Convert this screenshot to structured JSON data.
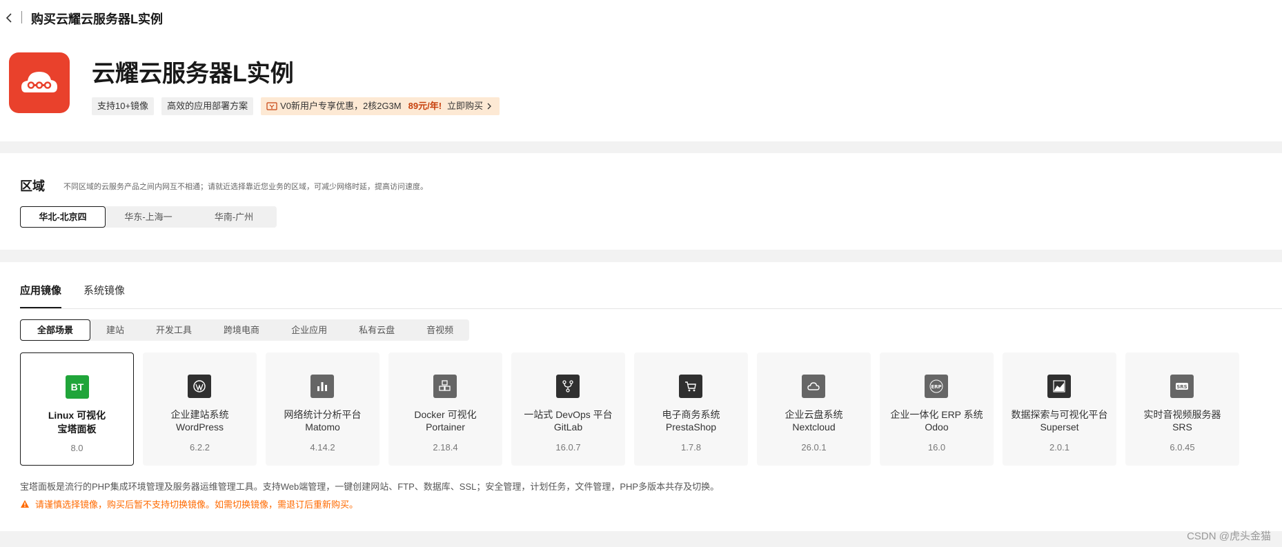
{
  "header": {
    "title": "购买云耀云服务器L实例"
  },
  "hero": {
    "title": "云耀云服务器L实例",
    "tags": [
      "支持10+镜像",
      "高效的应用部署方案"
    ],
    "promo": {
      "text": "V0新用户专享优惠，2核2G3M",
      "price": "89元/年!",
      "link": "立即购买"
    }
  },
  "region": {
    "label": "区域",
    "description": "不同区域的云服务产品之间内网互不相通；请就近选择靠近您业务的区域，可减少网络时延，提高访问速度。",
    "options": [
      "华北-北京四",
      "华东-上海一",
      "华南-广州"
    ],
    "selected": "华北-北京四"
  },
  "images": {
    "tabs": [
      "应用镜像",
      "系统镜像"
    ],
    "active_tab": "应用镜像",
    "categories": [
      "全部场景",
      "建站",
      "开发工具",
      "跨境电商",
      "企业应用",
      "私有云盘",
      "音视频"
    ],
    "active_category": "全部场景",
    "cards": [
      {
        "line1": "Linux 可视化",
        "line2": "宝塔面板",
        "version": "8.0",
        "icon": "bt-icon"
      },
      {
        "line1": "企业建站系统",
        "line2": "WordPress",
        "version": "6.2.2",
        "icon": "wordpress-icon"
      },
      {
        "line1": "网络统计分析平台",
        "line2": "Matomo",
        "version": "4.14.2",
        "icon": "bar-chart-icon"
      },
      {
        "line1": "Docker 可视化",
        "line2": "Portainer",
        "version": "2.18.4",
        "icon": "cubes-icon"
      },
      {
        "line1": "一站式 DevOps 平台",
        "line2": "GitLab",
        "version": "16.0.7",
        "icon": "branch-icon"
      },
      {
        "line1": "电子商务系统",
        "line2": "PrestaShop",
        "version": "1.7.8",
        "icon": "cart-icon"
      },
      {
        "line1": "企业云盘系统",
        "line2": "Nextcloud",
        "version": "26.0.1",
        "icon": "cloud-icon"
      },
      {
        "line1": "企业一体化 ERP 系统",
        "line2": "Odoo",
        "version": "16.0",
        "icon": "erp-icon"
      },
      {
        "line1": "数据探索与可视化平台",
        "line2": "Superset",
        "version": "2.0.1",
        "icon": "area-chart-icon"
      },
      {
        "line1": "实时音视频服务器",
        "line2": "SRS",
        "version": "6.0.45",
        "icon": "srs-icon"
      }
    ],
    "selected_index": 0,
    "description": "宝塔面板是流行的PHP集成环境管理及服务器运维管理工具。支持Web端管理，一键创建网站、FTP、数据库、SSL；安全管理，计划任务，文件管理，PHP多版本共存及切换。",
    "warning": "请谨慎选择镜像，购买后暂不支持切换镜像。如需切换镜像，需退订后重新购买。"
  },
  "watermark": "CSDN @虎头金猫",
  "colors": {
    "accent_red": "#e9412c",
    "bt_green": "#20a53a",
    "warning": "#ff6a00",
    "promo_bg": "#fde9d4"
  }
}
